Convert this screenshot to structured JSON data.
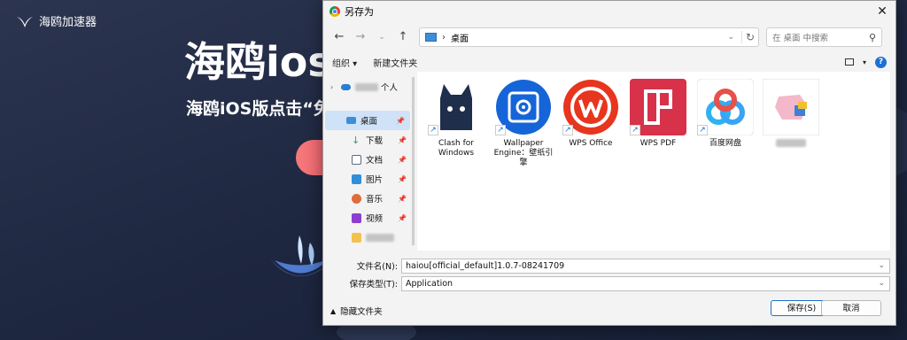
{
  "background": {
    "brand": "海鸥加速器",
    "hero_title": "海鸥ios",
    "hero_subtitle": "海鸥iOS版点击“免"
  },
  "dialog": {
    "title": "另存为",
    "address": {
      "location": "桌面",
      "search_placeholder": "在 桌面 中搜索"
    },
    "toolbar": {
      "organize": "组织 ▾",
      "new_folder": "新建文件夹"
    },
    "nav": [
      {
        "label": "个人",
        "icon": "onedrive-icon",
        "color": "#2b7cd3",
        "blurred_prefix": true
      },
      {
        "label": "桌面",
        "icon": "desktop-icon",
        "color": "#3d8ed6",
        "selected": true,
        "pinned": true
      },
      {
        "label": "下载",
        "icon": "download-icon",
        "color": "#2f9e6a",
        "pinned": true
      },
      {
        "label": "文档",
        "icon": "document-icon",
        "color": "#5a6b80",
        "pinned": true
      },
      {
        "label": "图片",
        "icon": "pictures-icon",
        "color": "#2f8fd8",
        "pinned": true
      },
      {
        "label": "音乐",
        "icon": "music-icon",
        "color": "#e06b3c",
        "pinned": true
      },
      {
        "label": "视频",
        "icon": "video-icon",
        "color": "#8c3fd1",
        "pinned": true
      },
      {
        "label": "",
        "icon": "folder-icon",
        "color": "#f2c14e",
        "blurred": true
      }
    ],
    "files": [
      {
        "label": "Clash for Windows",
        "icon": "clash-cat-icon"
      },
      {
        "label": "Wallpaper Engine：壁纸引擎",
        "icon": "wallpaper-engine-icon"
      },
      {
        "label": "WPS Office",
        "icon": "wps-office-icon"
      },
      {
        "label": "WPS PDF",
        "icon": "wps-pdf-icon"
      },
      {
        "label": "百度网盘",
        "icon": "baidu-netdisk-icon"
      },
      {
        "label": "",
        "icon": "blurred-app-icon"
      }
    ],
    "filename_label": "文件名(N):",
    "filename_value": "haiou[official_default]1.0.7-08241709",
    "filetype_label": "保存类型(T):",
    "filetype_value": "Application",
    "hide_folders": "隐藏文件夹",
    "save_button": "保存(S)",
    "cancel_button": "取消"
  }
}
